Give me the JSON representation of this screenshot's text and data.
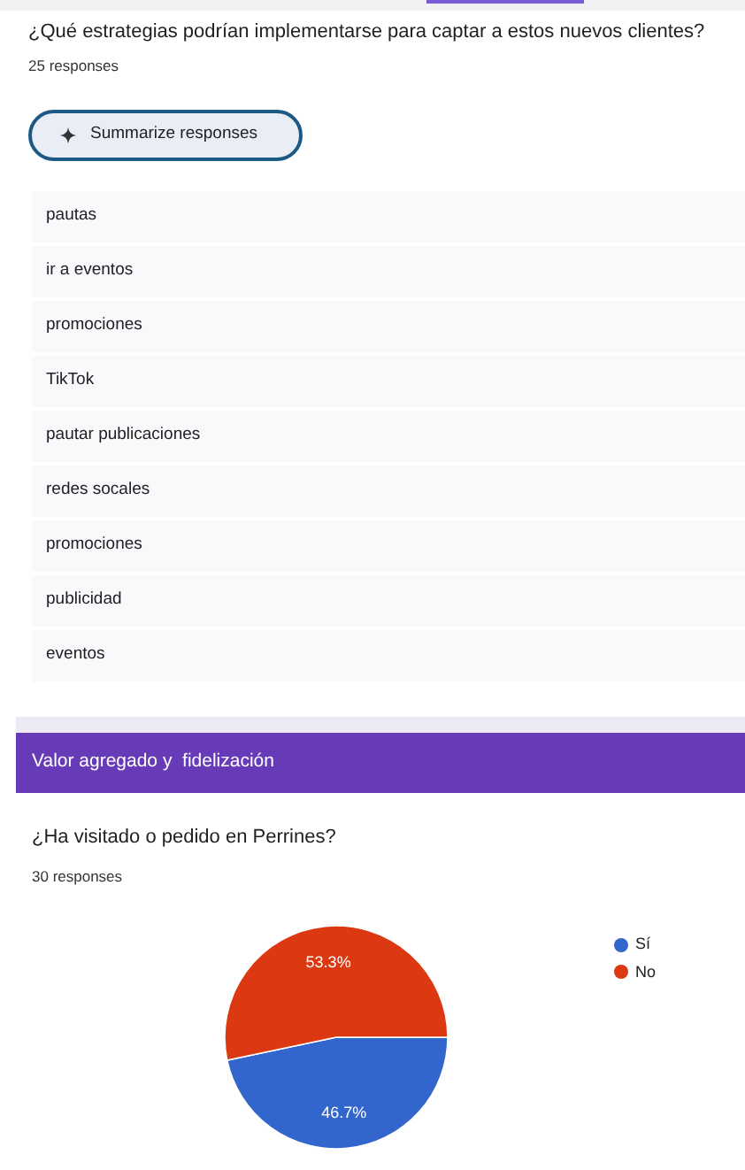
{
  "question_1": {
    "title": "¿Qué estrategias podrían implementarse para captar a estos nuevos clientes?",
    "count": "25 responses",
    "summarize_button": "Summarize responses",
    "responses": [
      "pautas",
      "ir a eventos",
      "promociones",
      "TikTok",
      "pautar publicaciones",
      "redes socales",
      "promociones",
      "publicidad",
      "eventos"
    ]
  },
  "section": {
    "title": "Valor agregado y  fidelización"
  },
  "question_2": {
    "title": "¿Ha visitado o pedido en Perrines?",
    "count": "30 responses",
    "chart_data": {
      "type": "pie",
      "categories": [
        "Sí",
        "No"
      ],
      "series": [
        {
          "values": [
            46.7,
            53.3
          ]
        }
      ],
      "colors": [
        "#3366cc",
        "#dc3912"
      ],
      "value_labels": [
        "46.7%",
        "53.3%"
      ],
      "legend": "right"
    }
  }
}
